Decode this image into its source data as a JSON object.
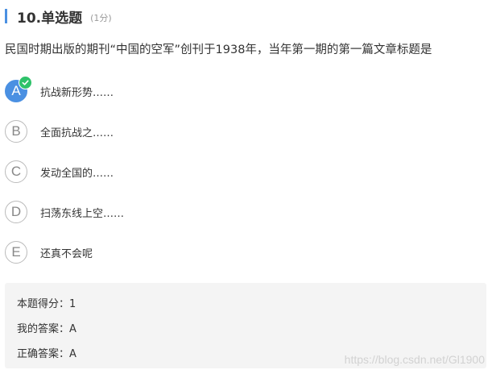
{
  "header": {
    "title": "10.单选题",
    "score": "(1分)"
  },
  "question": {
    "text": "民国时期出版的期刊“中国的空军”创刊于1938年，当年第一期的第一篇文章标题是"
  },
  "options": [
    {
      "letter": "A",
      "text": "抗战新形势……",
      "selected": true
    },
    {
      "letter": "B",
      "text": "全面抗战之……",
      "selected": false
    },
    {
      "letter": "C",
      "text": "发动全国的……",
      "selected": false
    },
    {
      "letter": "D",
      "text": "扫荡东线上空……",
      "selected": false
    },
    {
      "letter": "E",
      "text": "还真不会呢",
      "selected": false
    }
  ],
  "result": {
    "score_line": "本题得分：1",
    "my_answer_line": "我的答案：A",
    "correct_answer_line": "正确答案：A"
  },
  "watermark": "https://blog.csdn.net/Gl1900",
  "colors": {
    "accent": "#4a90e2",
    "check": "#2ec26a",
    "answer_bg": "#f4f4f4"
  }
}
